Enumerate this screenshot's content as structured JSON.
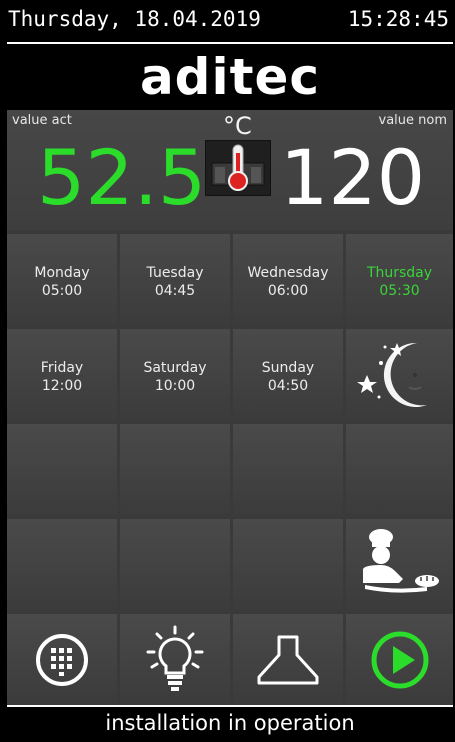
{
  "header": {
    "date": "Thursday, 18.04.2019",
    "time": "15:28:45"
  },
  "logo": {
    "text": "aditec"
  },
  "temperature": {
    "value_act_label": "value act",
    "value_nom_label": "value nom",
    "unit": "°C",
    "actual": "52.5",
    "nominal": "120",
    "actual_color": "#2bdc2b"
  },
  "schedule": [
    {
      "day": "Monday",
      "time": "05:00",
      "active": false
    },
    {
      "day": "Tuesday",
      "time": "04:45",
      "active": false
    },
    {
      "day": "Wednesday",
      "time": "06:00",
      "active": false
    },
    {
      "day": "Thursday",
      "time": "05:30",
      "active": true
    },
    {
      "day": "Friday",
      "time": "12:00",
      "active": false
    },
    {
      "day": "Saturday",
      "time": "10:00",
      "active": false
    },
    {
      "day": "Sunday",
      "time": "04:50",
      "active": false
    }
  ],
  "icons": {
    "night_mode": "moon-stars-icon",
    "baker": "baker-icon",
    "menu": "keypad-icon",
    "light": "light-bulb-icon",
    "hood": "extractor-hood-icon",
    "start": "play-icon",
    "thermometer": "thermometer-icon"
  },
  "colors": {
    "accent_green": "#2bdc2b",
    "panel": "#3a3a3a"
  },
  "status": {
    "text": "installation in operation"
  }
}
